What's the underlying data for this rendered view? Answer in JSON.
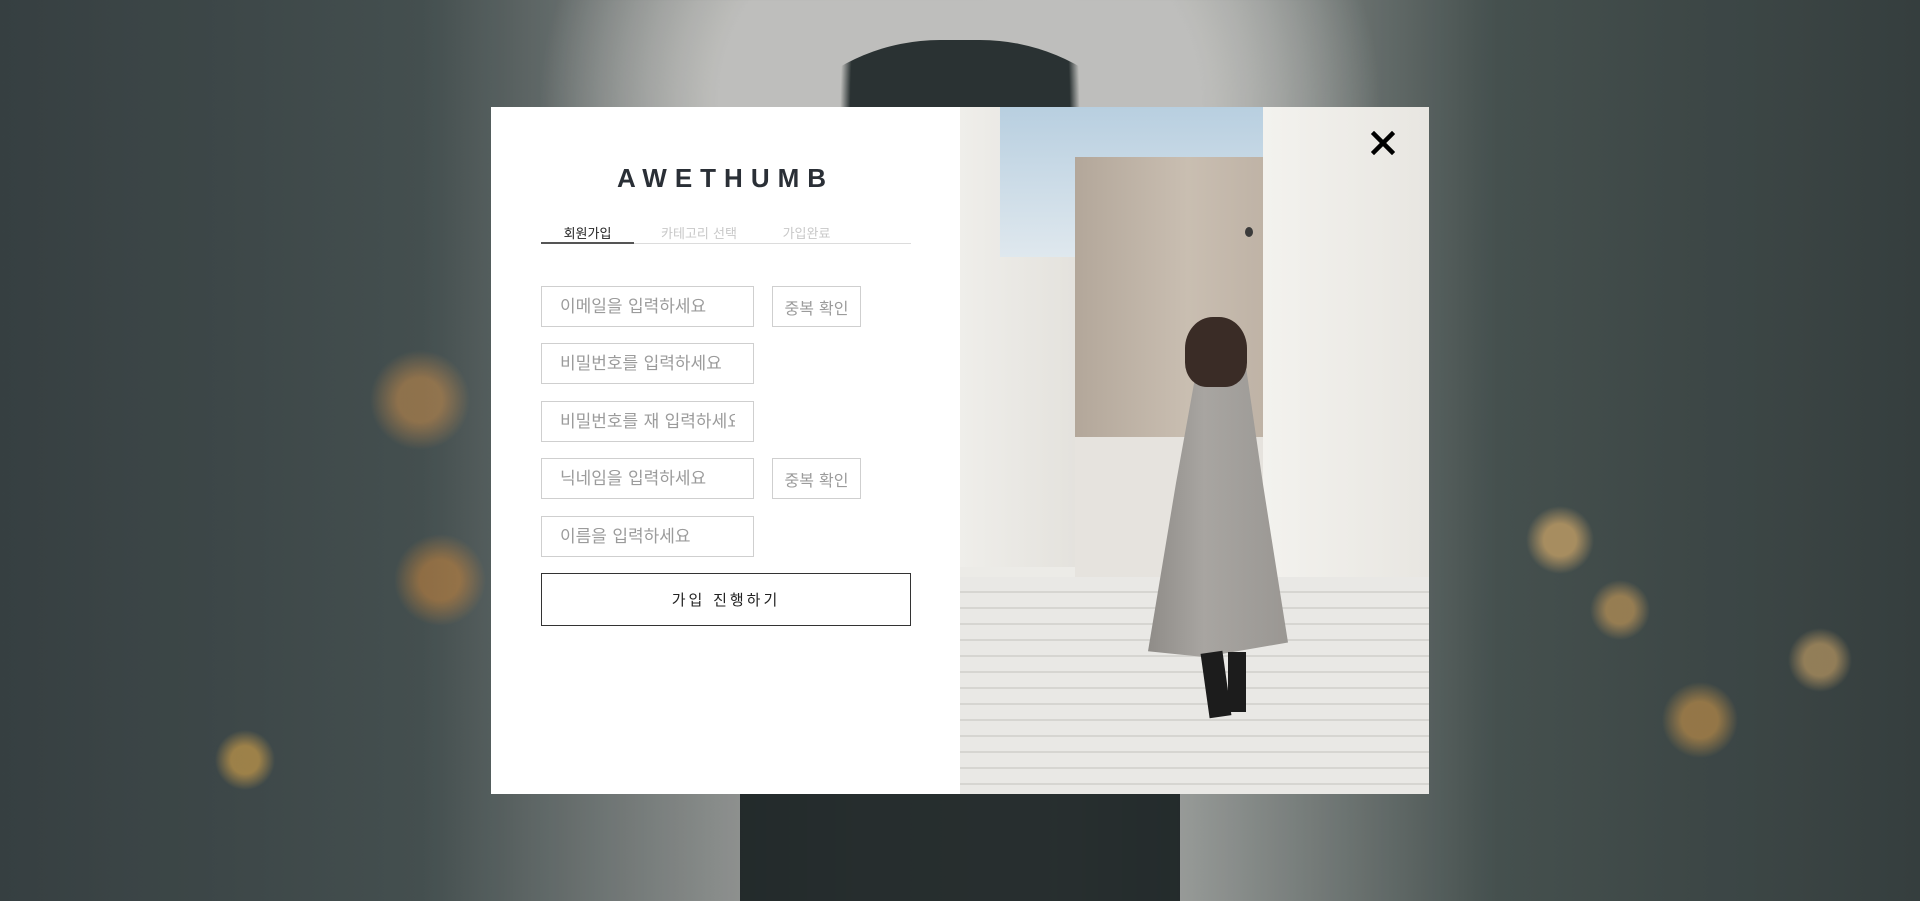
{
  "brand": {
    "logo": "AWETHUMB"
  },
  "tabs": [
    {
      "label": "회원가입",
      "active": true
    },
    {
      "label": "카테고리 선택",
      "active": false
    },
    {
      "label": "가입완료",
      "active": false
    }
  ],
  "form": {
    "email_placeholder": "이메일을 입력하세요",
    "email_check_label": "중복 확인",
    "password_placeholder": "비밀번호를 입력하세요",
    "password_confirm_placeholder": "비밀번호를 재 입력하세요",
    "nickname_placeholder": "닉네임을 입력하세요",
    "nickname_check_label": "중복 확인",
    "name_placeholder": "이름을 입력하세요",
    "submit_label": "가입 진행하기"
  },
  "icons": {
    "close": "close-icon"
  }
}
